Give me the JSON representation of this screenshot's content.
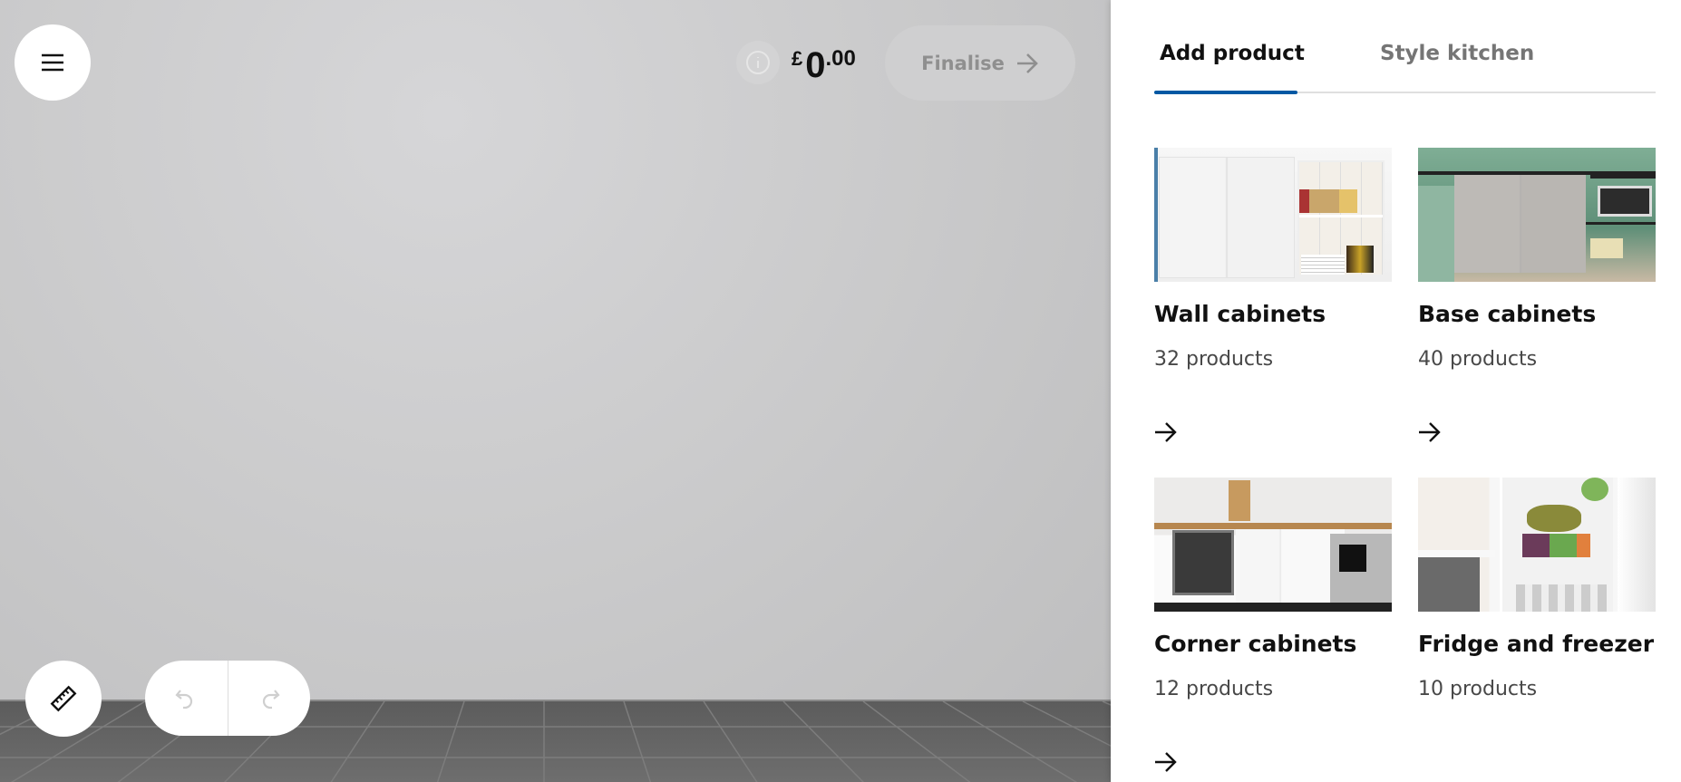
{
  "toolbar": {
    "menu_icon": "hamburger-icon",
    "info_icon": "info-icon",
    "price": {
      "currency": "£",
      "integer": "0",
      "decimal": ".00"
    },
    "finalise_label": "Finalise"
  },
  "canvas_controls": {
    "measure_icon": "ruler-icon",
    "undo_icon": "undo-icon",
    "redo_icon": "redo-icon"
  },
  "panel": {
    "tabs": [
      {
        "label": "Add product",
        "active": true
      },
      {
        "label": "Style kitchen",
        "active": false
      }
    ],
    "accent_color": "#0058a3",
    "categories": [
      {
        "title": "Wall cabinets",
        "count": "32 products"
      },
      {
        "title": "Base cabinets",
        "count": "40 products"
      },
      {
        "title": "Corner cabinets",
        "count": "12 products"
      },
      {
        "title": "Fridge and freezer",
        "count": "10 products"
      }
    ]
  }
}
